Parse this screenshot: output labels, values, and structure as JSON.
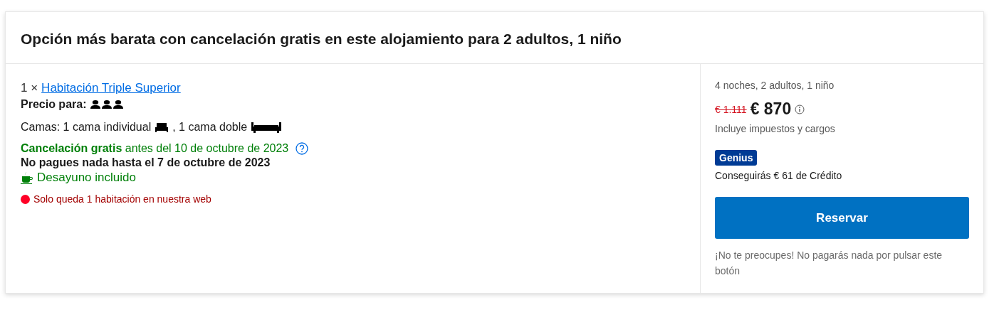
{
  "title": "Opción más barata con cancelación gratis en este alojamiento para 2 adultos, 1 niño",
  "room": {
    "quantity": "1 ×",
    "name": "Habitación Triple Superior",
    "price_for": "Precio para:"
  },
  "beds": {
    "label": "Camas: 1 cama individual",
    "separator": ", 1 cama doble"
  },
  "cancellation": "**Cancelación gratis** antes del 10 de octubre de 2023",
  "no_payment": "No pagues nada hasta el 7 de octubre de 2023",
  "breakfast": "Desayuno incluido",
  "availability": "Solo queda 1 habitación en nuestra web",
  "summary": {
    "stay": "4 noches, 2 adultos, 1 niño",
    "old_price": "€ 1.111",
    "price": "€ 870",
    "taxes": "Incluye impuestos y cargos",
    "badge": "Genius",
    "credit": "Conseguirás € 61 de Crédito",
    "button": "Reservar",
    "note": "¡No te preocupes! No pagarás nada por pulsar este botón"
  }
}
